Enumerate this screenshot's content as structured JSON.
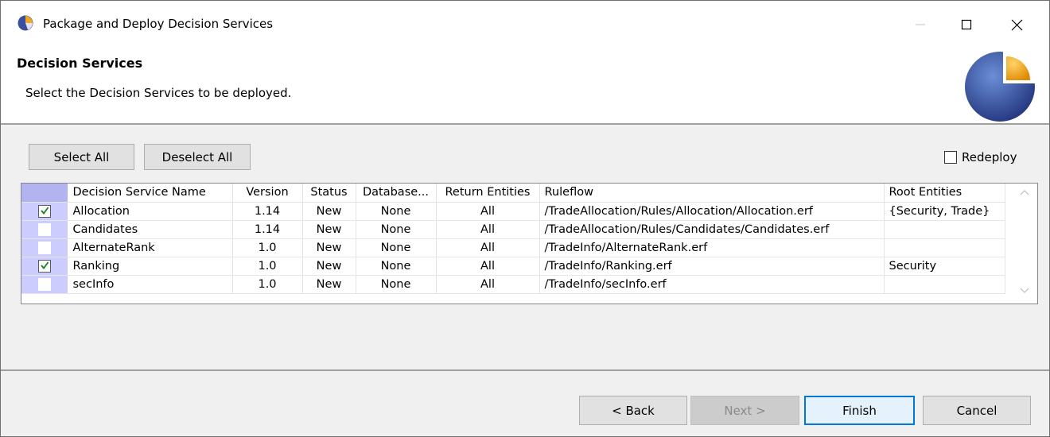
{
  "window": {
    "title": "Package and Deploy Decision Services",
    "minimize_icon": "minimize-icon",
    "maximize_icon": "maximize-icon",
    "close_icon": "close-icon"
  },
  "header": {
    "title": "Decision Services",
    "description": "Select the Decision Services to be deployed."
  },
  "toolbar": {
    "select_all_label": "Select All",
    "deselect_all_label": "Deselect All",
    "redeploy_label": "Redeploy",
    "redeploy_checked": false
  },
  "table": {
    "columns": [
      "Decision Service Name",
      "Version",
      "Status",
      "Database...",
      "Return Entities",
      "Ruleflow",
      "Root Entities"
    ],
    "rows": [
      {
        "checked": true,
        "name": "Allocation",
        "version": "1.14",
        "status": "New",
        "database": "None",
        "return_entities": "All",
        "ruleflow": "/TradeAllocation/Rules/Allocation/Allocation.erf",
        "root_entities": "{Security, Trade}"
      },
      {
        "checked": false,
        "name": "Candidates",
        "version": "1.14",
        "status": "New",
        "database": "None",
        "return_entities": "All",
        "ruleflow": "/TradeAllocation/Rules/Candidates/Candidates.erf",
        "root_entities": ""
      },
      {
        "checked": false,
        "name": "AlternateRank",
        "version": "1.0",
        "status": "New",
        "database": "None",
        "return_entities": "All",
        "ruleflow": "/TradeInfo/AlternateRank.erf",
        "root_entities": ""
      },
      {
        "checked": true,
        "name": "Ranking",
        "version": "1.0",
        "status": "New",
        "database": "None",
        "return_entities": "All",
        "ruleflow": "/TradeInfo/Ranking.erf",
        "root_entities": "Security"
      },
      {
        "checked": false,
        "name": "secInfo",
        "version": "1.0",
        "status": "New",
        "database": "None",
        "return_entities": "All",
        "ruleflow": "/TradeInfo/secInfo.erf",
        "root_entities": ""
      }
    ]
  },
  "footer": {
    "back_label": "< Back",
    "next_label": "Next >",
    "finish_label": "Finish",
    "cancel_label": "Cancel"
  },
  "colors": {
    "selection_column": "#ccccff",
    "focus_border": "#0078d7",
    "check_mark": "#1a7f1a"
  }
}
